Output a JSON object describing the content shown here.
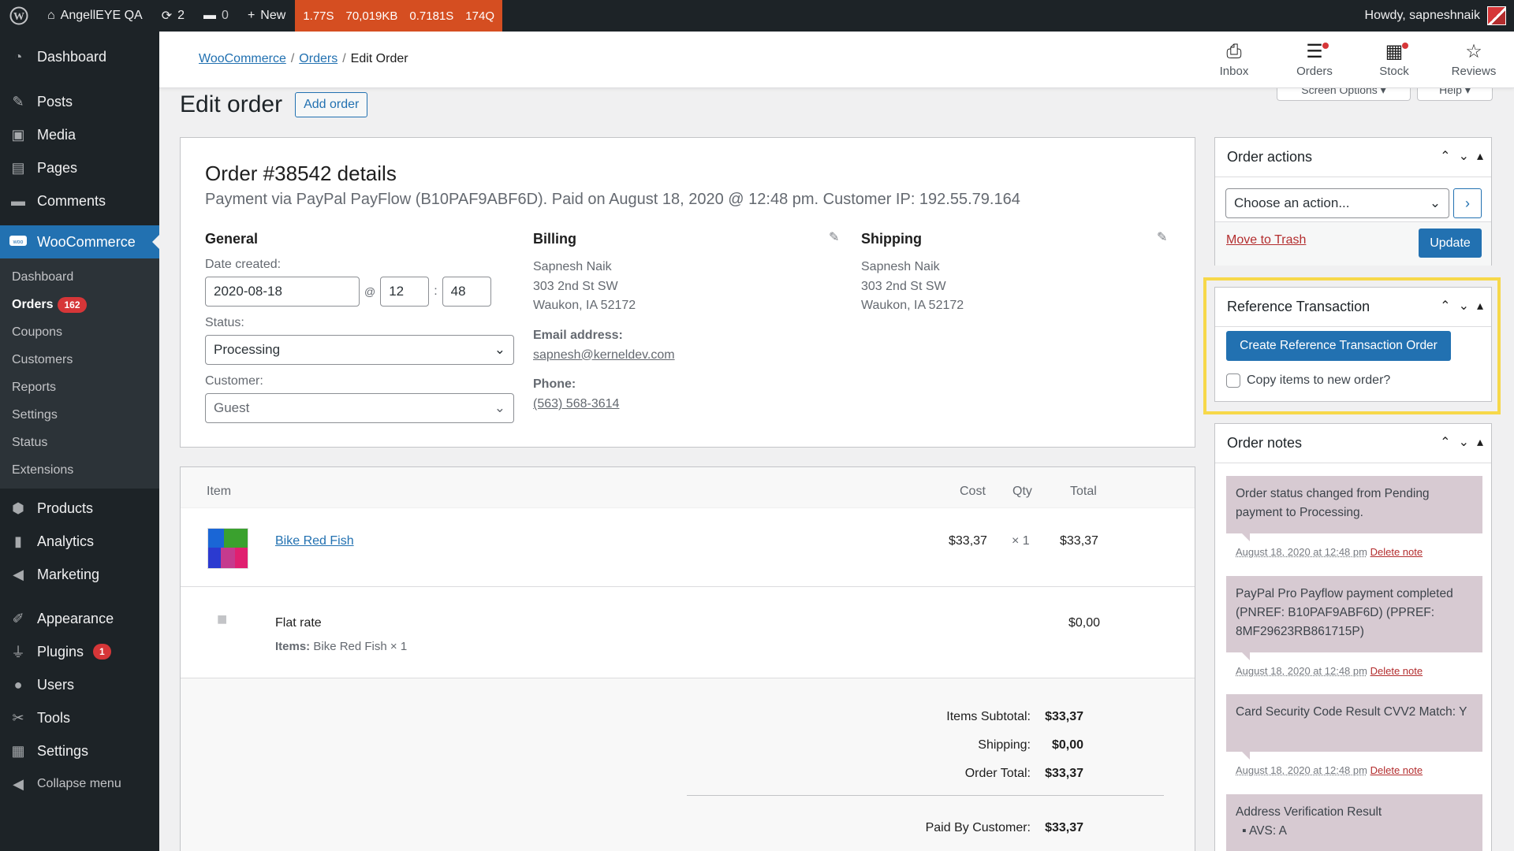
{
  "adminbar": {
    "site": "AngellEYE QA",
    "updates": "2",
    "comments": "0",
    "new": "New",
    "qm": [
      "1.77S",
      "70,019KB",
      "0.7181S",
      "174Q"
    ],
    "howdy": "Howdy, sapneshnaik"
  },
  "sidebar": {
    "items": [
      {
        "label": "Dashboard",
        "icon": "dashboard-icon"
      },
      {
        "label": "Posts",
        "icon": "pin-icon"
      },
      {
        "label": "Media",
        "icon": "media-icon"
      },
      {
        "label": "Pages",
        "icon": "pages-icon"
      },
      {
        "label": "Comments",
        "icon": "comment-icon"
      },
      {
        "label": "WooCommerce",
        "icon": "woo-icon"
      }
    ],
    "submenu": [
      "Dashboard",
      "Orders",
      "Coupons",
      "Customers",
      "Reports",
      "Settings",
      "Status",
      "Extensions"
    ],
    "orders_badge": "162",
    "items2": [
      {
        "label": "Products"
      },
      {
        "label": "Analytics"
      },
      {
        "label": "Marketing"
      },
      {
        "label": "Appearance"
      },
      {
        "label": "Plugins"
      },
      {
        "label": "Users"
      },
      {
        "label": "Tools"
      },
      {
        "label": "Settings"
      },
      {
        "label": "Collapse menu"
      }
    ],
    "plugins_badge": "1"
  },
  "header": {
    "crumbs": [
      "WooCommerce",
      "Orders",
      "Edit Order"
    ],
    "buttons": [
      "Inbox",
      "Orders",
      "Stock",
      "Reviews"
    ],
    "screen_options": "Screen Options",
    "help": "Help"
  },
  "page": {
    "title": "Edit order",
    "add_order": "Add order"
  },
  "order": {
    "title": "Order #38542 details",
    "payment": "Payment via PayPal PayFlow (B10PAF9ABF6D). Paid on August 18, 2020 @ 12:48 pm. Customer IP: 192.55.79.164",
    "general": {
      "heading": "General",
      "date_label": "Date created:",
      "date": "2020-08-18",
      "at": "@",
      "hour": "12",
      "colon": ":",
      "minute": "48",
      "status_label": "Status:",
      "status": "Processing",
      "customer_label": "Customer:",
      "customer": "Guest"
    },
    "billing": {
      "heading": "Billing",
      "name": "Sapnesh Naik",
      "street": "303 2nd St SW",
      "city": "Waukon, IA 52172",
      "email_label": "Email address:",
      "email": "sapnesh@kerneldev.com",
      "phone_label": "Phone:",
      "phone": "(563) 568-3614"
    },
    "shipping": {
      "heading": "Shipping",
      "name": "Sapnesh Naik",
      "street": "303 2nd St SW",
      "city": "Waukon, IA 52172"
    }
  },
  "items": {
    "headers": {
      "item": "Item",
      "cost": "Cost",
      "qty": "Qty",
      "total": "Total"
    },
    "line": {
      "name": "Bike Red Fish",
      "cost": "$33,37",
      "qty": "× 1",
      "total": "$33,37"
    },
    "ship": {
      "name": "Flat rate",
      "items_label": "Items:",
      "items": "Bike Red Fish × 1",
      "total": "$0,00"
    },
    "totals": {
      "subtotal_label": "Items Subtotal:",
      "subtotal": "$33,37",
      "shipping_label": "Shipping:",
      "shipping": "$0,00",
      "total_label": "Order Total:",
      "total": "$33,37",
      "paid_label": "Paid By Customer:",
      "paid": "$33,37"
    }
  },
  "actions": {
    "title": "Order actions",
    "choose": "Choose an action...",
    "trash": "Move to Trash",
    "update": "Update"
  },
  "reference": {
    "title": "Reference Transaction",
    "create": "Create Reference Transaction Order",
    "copy": "Copy items to new order?"
  },
  "notes": {
    "title": "Order notes",
    "delete": "Delete note",
    "list": [
      {
        "text": "Order status changed from Pending payment to Processing.",
        "date": "August 18, 2020 at 12:48 pm"
      },
      {
        "text": "PayPal Pro Payflow payment completed (PNREF: B10PAF9ABF6D) (PPREF: 8MF29623RB861715P)",
        "date": "August 18, 2020 at 12:48 pm"
      },
      {
        "text": "Card Security Code Result CVV2 Match: Y",
        "date": "August 18, 2020 at 12:48 pm"
      },
      {
        "text": "Address Verification Result",
        "bullet": "AVS: A"
      }
    ]
  }
}
